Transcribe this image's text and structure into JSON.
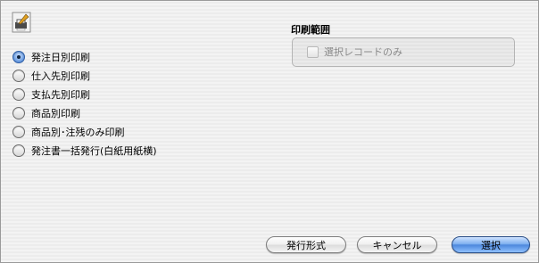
{
  "print_options": [
    {
      "label": "発注日別印刷",
      "selected": true
    },
    {
      "label": "仕入先別印刷",
      "selected": false
    },
    {
      "label": "支払先別印刷",
      "selected": false
    },
    {
      "label": "商品別印刷",
      "selected": false
    },
    {
      "label": "商品別･注残のみ印刷",
      "selected": false
    },
    {
      "label": "発注書一括発行(白紙用紙横)",
      "selected": false
    }
  ],
  "print_range": {
    "title": "印刷範囲",
    "checkbox_label": "選択レコードのみ",
    "checkbox_checked": false,
    "checkbox_enabled": false
  },
  "buttons": {
    "format": "発行形式",
    "cancel": "キャンセル",
    "select": "選択"
  },
  "colors": {
    "primary_button": "#4d88dc",
    "radio_selected": "#3a6fc4"
  },
  "icons": {
    "app": "printer-icon"
  }
}
